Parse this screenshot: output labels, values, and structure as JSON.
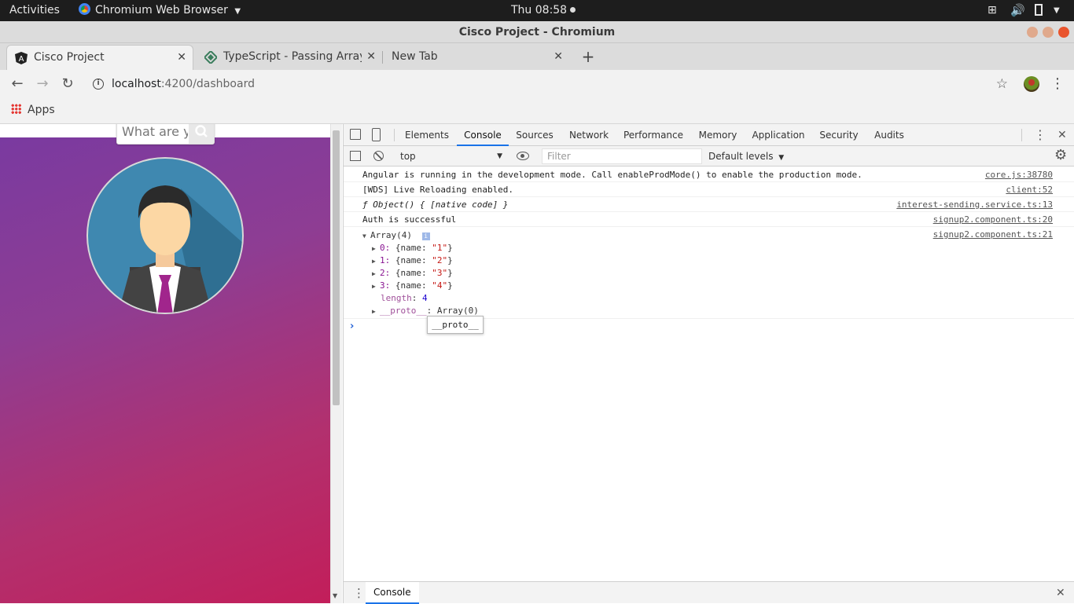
{
  "topbar": {
    "activities": "Activities",
    "app_name": "Chromium Web Browser",
    "clock": "Thu 08:58"
  },
  "window": {
    "title": "Cisco Project - Chromium"
  },
  "tabs": [
    {
      "label": "Cisco Project",
      "active": true
    },
    {
      "label": "TypeScript - Passing Array",
      "active": false
    },
    {
      "label": "New Tab",
      "active": false
    }
  ],
  "toolbar": {
    "url_host": "localhost",
    "url_path": ":4200/dashboard"
  },
  "bookmarks": {
    "apps_label": "Apps"
  },
  "page": {
    "search_placeholder": "What are yo"
  },
  "devtools": {
    "tabs": [
      "Elements",
      "Console",
      "Sources",
      "Network",
      "Performance",
      "Memory",
      "Application",
      "Security",
      "Audits"
    ],
    "active_tab": "Console",
    "context": "top",
    "filter_placeholder": "Filter",
    "levels": "Default levels",
    "messages": [
      {
        "text": "Angular is running in the development mode. Call enableProdMode() to enable the production mode.",
        "source": "core.js:38780"
      },
      {
        "text": "[WDS] Live Reloading enabled.",
        "source": "client:52"
      },
      {
        "text": "ƒ Object() { [native code] }",
        "source": "interest-sending.service.ts:13"
      },
      {
        "text": "Auth is successful",
        "source": "signup2.component.ts:20"
      }
    ],
    "array_log": {
      "header": "Array(4)",
      "source": "signup2.component.ts:21",
      "items": [
        {
          "index": "0:",
          "key": "{name: ",
          "value": "\"1\"",
          "end": "}"
        },
        {
          "index": "1:",
          "key": "{name: ",
          "value": "\"2\"",
          "end": "}"
        },
        {
          "index": "2:",
          "key": "{name: ",
          "value": "\"3\"",
          "end": "}"
        },
        {
          "index": "3:",
          "key": "{name: ",
          "value": "\"4\"",
          "end": "}"
        }
      ],
      "length_key": "length",
      "length_value": "4",
      "proto_key": "__proto__",
      "proto_value": ": Array(0)"
    },
    "tooltip": "__proto__",
    "drawer_tab": "Console"
  }
}
